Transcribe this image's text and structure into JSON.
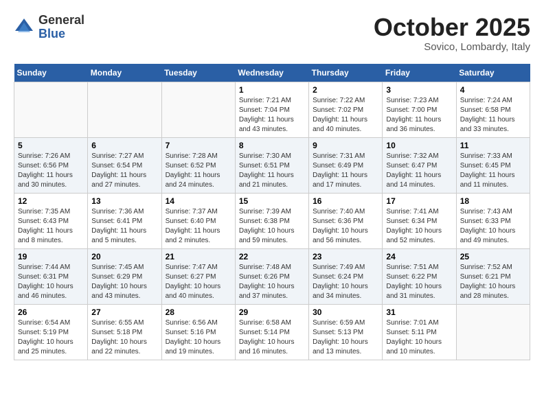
{
  "header": {
    "logo": {
      "general": "General",
      "blue": "Blue"
    },
    "title": "October 2025",
    "subtitle": "Sovico, Lombardy, Italy"
  },
  "calendar": {
    "days_of_week": [
      "Sunday",
      "Monday",
      "Tuesday",
      "Wednesday",
      "Thursday",
      "Friday",
      "Saturday"
    ],
    "weeks": [
      [
        {
          "day": "",
          "info": ""
        },
        {
          "day": "",
          "info": ""
        },
        {
          "day": "",
          "info": ""
        },
        {
          "day": "1",
          "info": "Sunrise: 7:21 AM\nSunset: 7:04 PM\nDaylight: 11 hours and 43 minutes."
        },
        {
          "day": "2",
          "info": "Sunrise: 7:22 AM\nSunset: 7:02 PM\nDaylight: 11 hours and 40 minutes."
        },
        {
          "day": "3",
          "info": "Sunrise: 7:23 AM\nSunset: 7:00 PM\nDaylight: 11 hours and 36 minutes."
        },
        {
          "day": "4",
          "info": "Sunrise: 7:24 AM\nSunset: 6:58 PM\nDaylight: 11 hours and 33 minutes."
        }
      ],
      [
        {
          "day": "5",
          "info": "Sunrise: 7:26 AM\nSunset: 6:56 PM\nDaylight: 11 hours and 30 minutes."
        },
        {
          "day": "6",
          "info": "Sunrise: 7:27 AM\nSunset: 6:54 PM\nDaylight: 11 hours and 27 minutes."
        },
        {
          "day": "7",
          "info": "Sunrise: 7:28 AM\nSunset: 6:52 PM\nDaylight: 11 hours and 24 minutes."
        },
        {
          "day": "8",
          "info": "Sunrise: 7:30 AM\nSunset: 6:51 PM\nDaylight: 11 hours and 21 minutes."
        },
        {
          "day": "9",
          "info": "Sunrise: 7:31 AM\nSunset: 6:49 PM\nDaylight: 11 hours and 17 minutes."
        },
        {
          "day": "10",
          "info": "Sunrise: 7:32 AM\nSunset: 6:47 PM\nDaylight: 11 hours and 14 minutes."
        },
        {
          "day": "11",
          "info": "Sunrise: 7:33 AM\nSunset: 6:45 PM\nDaylight: 11 hours and 11 minutes."
        }
      ],
      [
        {
          "day": "12",
          "info": "Sunrise: 7:35 AM\nSunset: 6:43 PM\nDaylight: 11 hours and 8 minutes."
        },
        {
          "day": "13",
          "info": "Sunrise: 7:36 AM\nSunset: 6:41 PM\nDaylight: 11 hours and 5 minutes."
        },
        {
          "day": "14",
          "info": "Sunrise: 7:37 AM\nSunset: 6:40 PM\nDaylight: 11 hours and 2 minutes."
        },
        {
          "day": "15",
          "info": "Sunrise: 7:39 AM\nSunset: 6:38 PM\nDaylight: 10 hours and 59 minutes."
        },
        {
          "day": "16",
          "info": "Sunrise: 7:40 AM\nSunset: 6:36 PM\nDaylight: 10 hours and 56 minutes."
        },
        {
          "day": "17",
          "info": "Sunrise: 7:41 AM\nSunset: 6:34 PM\nDaylight: 10 hours and 52 minutes."
        },
        {
          "day": "18",
          "info": "Sunrise: 7:43 AM\nSunset: 6:33 PM\nDaylight: 10 hours and 49 minutes."
        }
      ],
      [
        {
          "day": "19",
          "info": "Sunrise: 7:44 AM\nSunset: 6:31 PM\nDaylight: 10 hours and 46 minutes."
        },
        {
          "day": "20",
          "info": "Sunrise: 7:45 AM\nSunset: 6:29 PM\nDaylight: 10 hours and 43 minutes."
        },
        {
          "day": "21",
          "info": "Sunrise: 7:47 AM\nSunset: 6:27 PM\nDaylight: 10 hours and 40 minutes."
        },
        {
          "day": "22",
          "info": "Sunrise: 7:48 AM\nSunset: 6:26 PM\nDaylight: 10 hours and 37 minutes."
        },
        {
          "day": "23",
          "info": "Sunrise: 7:49 AM\nSunset: 6:24 PM\nDaylight: 10 hours and 34 minutes."
        },
        {
          "day": "24",
          "info": "Sunrise: 7:51 AM\nSunset: 6:22 PM\nDaylight: 10 hours and 31 minutes."
        },
        {
          "day": "25",
          "info": "Sunrise: 7:52 AM\nSunset: 6:21 PM\nDaylight: 10 hours and 28 minutes."
        }
      ],
      [
        {
          "day": "26",
          "info": "Sunrise: 6:54 AM\nSunset: 5:19 PM\nDaylight: 10 hours and 25 minutes."
        },
        {
          "day": "27",
          "info": "Sunrise: 6:55 AM\nSunset: 5:18 PM\nDaylight: 10 hours and 22 minutes."
        },
        {
          "day": "28",
          "info": "Sunrise: 6:56 AM\nSunset: 5:16 PM\nDaylight: 10 hours and 19 minutes."
        },
        {
          "day": "29",
          "info": "Sunrise: 6:58 AM\nSunset: 5:14 PM\nDaylight: 10 hours and 16 minutes."
        },
        {
          "day": "30",
          "info": "Sunrise: 6:59 AM\nSunset: 5:13 PM\nDaylight: 10 hours and 13 minutes."
        },
        {
          "day": "31",
          "info": "Sunrise: 7:01 AM\nSunset: 5:11 PM\nDaylight: 10 hours and 10 minutes."
        },
        {
          "day": "",
          "info": ""
        }
      ]
    ]
  }
}
